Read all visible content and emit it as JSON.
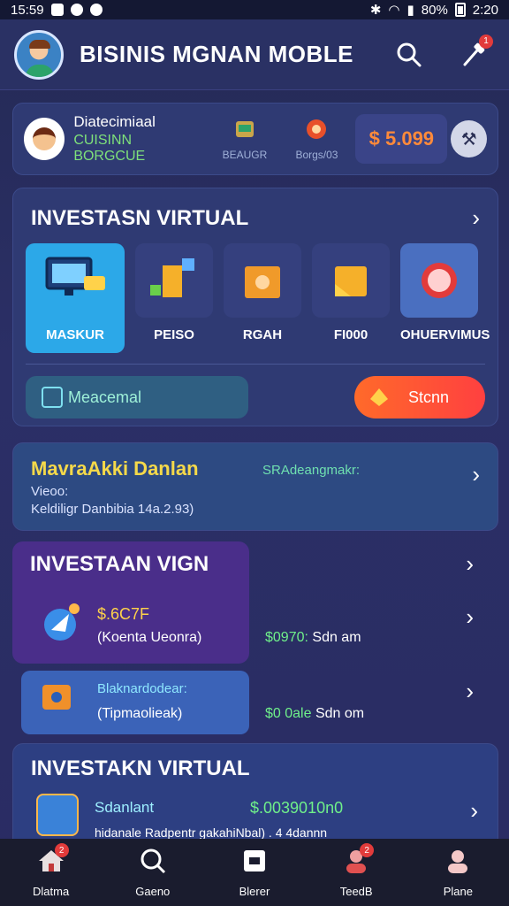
{
  "status_bar": {
    "time_left": "15:59",
    "battery_percent": "80%",
    "time_right": "2:20"
  },
  "header": {
    "title": "BISINIS MGNAN MOBLE",
    "notification_badge": "1"
  },
  "profile": {
    "name_line1": "Diatecimiaal",
    "name_line2": "CUISINN BORGCUE",
    "stat1_label": "BEAUGR",
    "stat2_label": "Borgs/03",
    "balance": "$ 5.099"
  },
  "investasi": {
    "title": "INVESTASN VIRTUAL",
    "tiles": [
      {
        "label": "MASKUR"
      },
      {
        "label": "PEISO"
      },
      {
        "label": "RGAH"
      },
      {
        "label": "FI000"
      },
      {
        "label": "OHUERVIMUS"
      }
    ],
    "btn_left": "Meacemal",
    "btn_right": "Stcnn"
  },
  "market": {
    "title": "MavraAkki Danlan",
    "right_text": "SRAdeangmakr:",
    "line2": "Vieoo:",
    "line3": "Keldiligr Danbibia 14a.2.93)"
  },
  "investasi_lain": {
    "title": "INVESTAAN VIGN",
    "row1": {
      "value": "$.6C7F",
      "sub": "(Koenta Ueonra)",
      "right_green": "$0970:",
      "right_white": "Sdn am"
    },
    "row2": {
      "title": "Blaknardodear:",
      "sub": "(Tipmaolieak)",
      "right_green": "$0 0ale",
      "right_white": "Sdn om"
    }
  },
  "investasi2": {
    "title": "INVESTAKN VIRTUAL",
    "name": "Sdanlant",
    "value": "$.0039010n0",
    "sub": "hidanale Radpentr gakahiNbal) . 4 4dannn"
  },
  "bottom_nav": [
    {
      "label": "Dlatma",
      "badge": "2"
    },
    {
      "label": "Gaeno",
      "badge": ""
    },
    {
      "label": "Blerer",
      "badge": ""
    },
    {
      "label": "TeedB",
      "badge": "2"
    },
    {
      "label": "Plane",
      "badge": ""
    }
  ],
  "colors": {
    "accent_orange": "#ff6a2a",
    "green": "#6ff08a",
    "yellow": "#f5d94a",
    "card_bg": "#2f3a73"
  }
}
